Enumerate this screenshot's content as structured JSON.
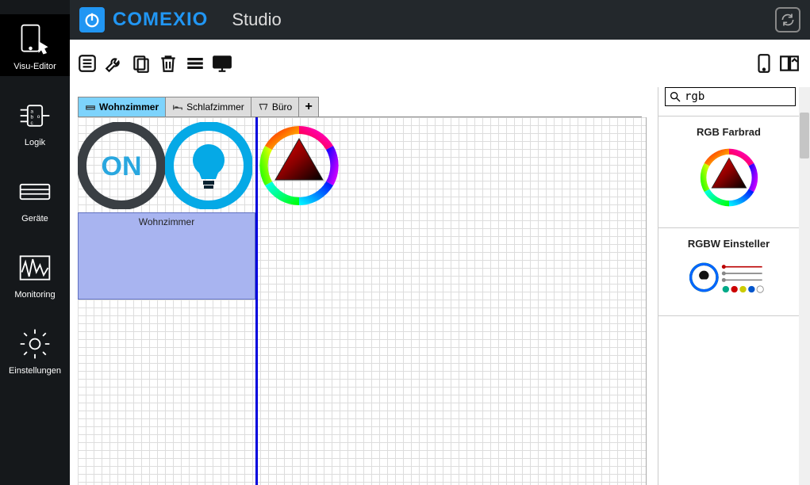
{
  "header": {
    "brand": "COMEXIO",
    "subtitle": "Studio"
  },
  "sidebar": {
    "items": [
      {
        "label": "Visu-Editor",
        "icon": "tablet-touch"
      },
      {
        "label": "Logik",
        "icon": "logic"
      },
      {
        "label": "Geräte",
        "icon": "device"
      },
      {
        "label": "Monitoring",
        "icon": "wave"
      },
      {
        "label": "Einstellungen",
        "icon": "gear"
      }
    ],
    "active_index": 0
  },
  "toolbar": {
    "left": [
      "list",
      "wrench",
      "copy",
      "trash",
      "lines",
      "monitor"
    ],
    "right": [
      "tablet",
      "split"
    ]
  },
  "search": {
    "value": "rgb",
    "placeholder": ""
  },
  "palette": {
    "items": [
      {
        "title": "RGB Farbrad",
        "kind": "rgb-wheel"
      },
      {
        "title": "RGBW Einsteller",
        "kind": "rgbw-sliders"
      }
    ]
  },
  "tabs": {
    "items": [
      {
        "label": "Wohnzimmer",
        "icon": "sofa"
      },
      {
        "label": "Schlafzimmer",
        "icon": "bed"
      },
      {
        "label": "Büro",
        "icon": "desk"
      }
    ],
    "active_index": 0,
    "add_label": "+"
  },
  "canvas": {
    "widgets": {
      "on_button": {
        "text": "ON"
      },
      "group_label": "Wohnzimmer"
    }
  }
}
